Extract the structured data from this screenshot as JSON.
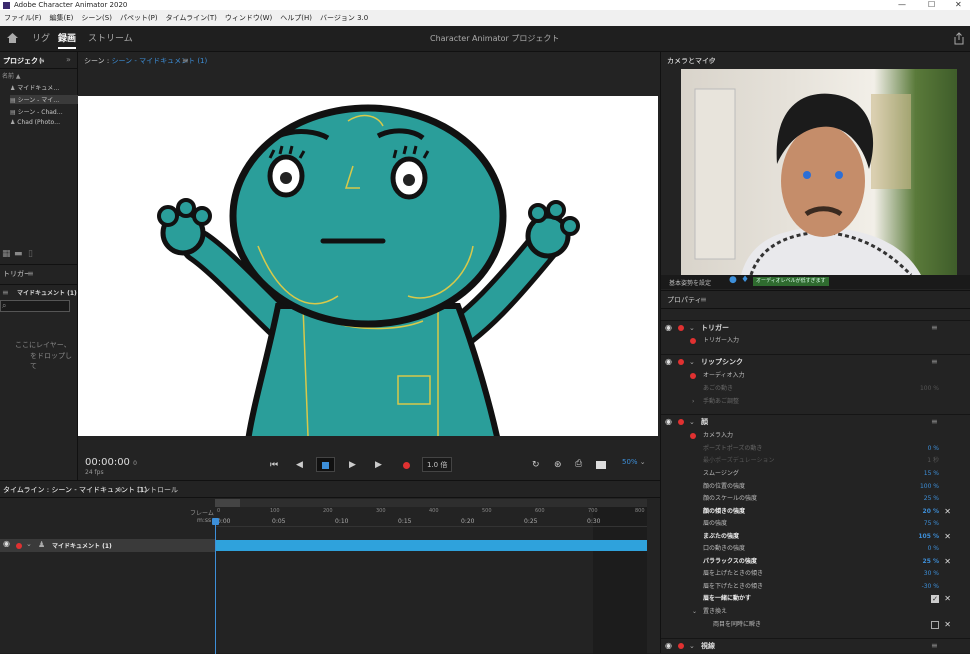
{
  "window": {
    "title": "Adobe Character Animator 2020"
  },
  "menu": [
    "ファイル(F)",
    "編集(E)",
    "シーン(S)",
    "パペット(P)",
    "タイムライン(T)",
    "ウィンドウ(W)",
    "ヘルプ(H)",
    "バージョン 3.0"
  ],
  "header": {
    "tabs": [
      "リグ",
      "録画",
      "ストリーム"
    ],
    "active_tab": "録画",
    "project_title": "Character Animator プロジェクト"
  },
  "project_panel": {
    "title": "プロジェクト",
    "name_col": "名前 ▲",
    "items": [
      "マイドキュメ…",
      "シーン - マイ…",
      "シーン - Chad…",
      "Chad (Photo…"
    ]
  },
  "triggers_panel": {
    "title": "トリガー",
    "puppet": "マイドキュメント (1)",
    "empty_text_1": "ここにレイヤー、",
    "empty_text_2": "をドロップして"
  },
  "scene_panel": {
    "title_prefix": "シーン :",
    "title_link": "シーン - マイドキュメント (1)",
    "timecode": "00:00:00",
    "timecode_suffix": "0",
    "fps": "24 fps",
    "speed": "1.0 倍",
    "zoom": "50%"
  },
  "timeline_panel": {
    "tab": "タイムライン : シーン - マイドキュメント (1)",
    "tab2": "コントロール",
    "frame_label": "フレーム",
    "mss_label": "m:ss",
    "frame_ticks": [
      "0",
      "100",
      "200",
      "300",
      "400",
      "500",
      "600",
      "700",
      "800"
    ],
    "time_ticks": [
      "0:00",
      "0:05",
      "0:10",
      "0:15",
      "0:20",
      "0:25",
      "0:30"
    ],
    "track": "マイドキュメント (1)"
  },
  "camera_panel": {
    "title": "カメラとマイク",
    "pose_label": "基本姿勢を設定",
    "audio_status": "オーディオレベルが低すぎます"
  },
  "properties_panel": {
    "title": "プロパティ",
    "groups": [
      {
        "name": "トリガー",
        "rows": [
          {
            "label": "トリガー入力"
          }
        ]
      },
      {
        "name": "リップシンク",
        "rows": [
          {
            "label": "オーディオ入力"
          },
          {
            "label": "あごの動き",
            "value": "100 %",
            "dim": true
          },
          {
            "label": "手動あご調整",
            "dim": true
          }
        ]
      },
      {
        "name": "顔",
        "rows": [
          {
            "label": "カメラ入力"
          },
          {
            "label": "ポーズトポーズの動き",
            "value": "0 %"
          },
          {
            "label": "最小ポーズデュレーション",
            "value": "1 秒",
            "dim": true
          },
          {
            "label": "スムージング",
            "value": "15 %"
          },
          {
            "label": "顔の位置の強度",
            "value": "100 %"
          },
          {
            "label": "顔のスケールの強度",
            "value": "25 %"
          },
          {
            "label": "顔の傾きの強度",
            "value": "20 %",
            "bold": true
          },
          {
            "label": "眉の強度",
            "value": "75 %"
          },
          {
            "label": "まぶたの強度",
            "value": "105 %",
            "bold": true
          },
          {
            "label": "口の動きの強度",
            "value": "0 %"
          },
          {
            "label": "パララックスの強度",
            "value": "25 %",
            "bold": true
          },
          {
            "label": "眉を上げたときの傾き",
            "value": "30 %"
          },
          {
            "label": "眉を下げたときの傾き",
            "value": "-30 %"
          },
          {
            "label": "眉を一緒に動かす",
            "bold": true
          },
          {
            "label": "置き換え"
          },
          {
            "label": "両目を同時に瞬き"
          }
        ]
      },
      {
        "name": "視線",
        "rows": []
      }
    ]
  },
  "colors": {
    "accent": "#3d8fd9",
    "record": "#e03131",
    "track": "#2fa2dc",
    "character": "#2a9e9a"
  }
}
